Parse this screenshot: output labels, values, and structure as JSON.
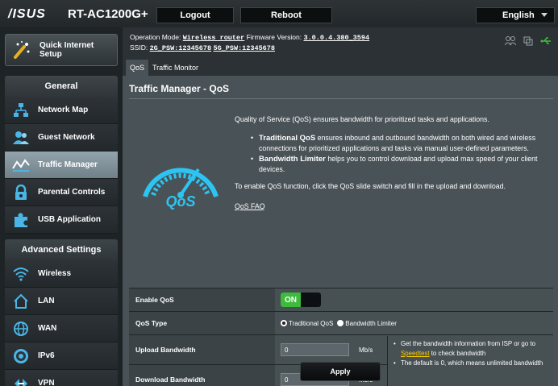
{
  "header": {
    "logo": "/ISUS",
    "model": "RT-AC1200G+",
    "logout": "Logout",
    "reboot": "Reboot",
    "language": "English"
  },
  "info": {
    "mode_label": "Operation Mode:",
    "mode_value": "Wireless router",
    "fw_label": "Firmware Version:",
    "fw_value": "3.0.0.4.380_3594",
    "ssid_label": "SSID:",
    "ssid_2g": "2G_PSW:12345678",
    "ssid_5g": "5G_PSW:12345678"
  },
  "sidebar": {
    "qis": "Quick Internet Setup",
    "general_title": "General",
    "general": [
      {
        "label": "Network Map",
        "icon": "network-map-icon"
      },
      {
        "label": "Guest Network",
        "icon": "guest-network-icon"
      },
      {
        "label": "Traffic Manager",
        "icon": "traffic-manager-icon"
      },
      {
        "label": "Parental Controls",
        "icon": "parental-controls-icon"
      },
      {
        "label": "USB Application",
        "icon": "usb-application-icon"
      }
    ],
    "advanced_title": "Advanced Settings",
    "advanced": [
      {
        "label": "Wireless",
        "icon": "wireless-icon"
      },
      {
        "label": "LAN",
        "icon": "lan-icon"
      },
      {
        "label": "WAN",
        "icon": "wan-icon"
      },
      {
        "label": "IPv6",
        "icon": "ipv6-icon"
      },
      {
        "label": "VPN",
        "icon": "vpn-icon"
      }
    ]
  },
  "tabs": [
    "QoS",
    "Traffic Monitor"
  ],
  "panel": {
    "title": "Traffic Manager - QoS",
    "intro": "Quality of Service (QoS) ensures bandwidth for prioritized tasks and applications.",
    "b1_title": "Traditional QoS",
    "b1_text": " ensures inbound and outbound bandwidth on both wired and wireless connections for prioritized applications and tasks via manual user-defined parameters.",
    "b2_title": "Bandwidth Limiter",
    "b2_text": " helps you to control download and upload max speed of your client devices.",
    "enable_text": "To enable QoS function, click the QoS slide switch and fill in the upload and download.",
    "faq": "QoS FAQ"
  },
  "settings": {
    "enable_label": "Enable QoS",
    "toggle": "ON",
    "type_label": "QoS Type",
    "type_opt1": "Traditional QoS",
    "type_opt2": "Bandwidth Limiter",
    "upload_label": "Upload Bandwidth",
    "upload_value": "0",
    "download_label": "Download Bandwidth",
    "download_value": "0",
    "unit": "Mb/s",
    "note1_a": "Get the bandwidth information from ISP or go to ",
    "note1_link": "Speedtest",
    "note1_b": " to check bandwidth",
    "note2": "The default is 0, which means unlimited bandwidth",
    "apply": "Apply"
  },
  "colors": {
    "accent_on": "#3dbb3d",
    "link": "#ffcc00",
    "active_menu": "#8a9ba4"
  }
}
